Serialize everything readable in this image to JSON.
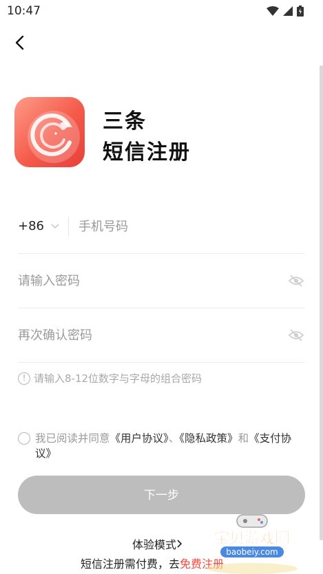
{
  "status_bar": {
    "time": "10:47"
  },
  "header": {
    "back_icon": "chevron-left-icon"
  },
  "brand": {
    "name": "三条",
    "title": "短信注册",
    "logo_colors": [
      "#ff9a88",
      "#e8403a"
    ]
  },
  "form": {
    "country_code": "+86",
    "phone_placeholder": "手机号码",
    "password_placeholder": "请输入密码",
    "confirm_placeholder": "再次确认密码",
    "hint": "请输入8-12位数字与字母的组合密码"
  },
  "agreement": {
    "prefix": "我已阅读并同意",
    "user_agreement": "《用户协议》",
    "sep": "、",
    "privacy_policy": "《隐私政策》",
    "and": "和",
    "payment_agreement": "《支付协议》"
  },
  "actions": {
    "next_label": "下一步",
    "next_color": "#bdbdbd"
  },
  "footer": {
    "demo_mode": "体验模式",
    "note_prefix": "短信注册需付费，去",
    "note_link": "免费注册",
    "link_color": "#f0493e"
  },
  "watermark": {
    "title": "宝贝游戏网",
    "url": "baobeiy.com"
  }
}
